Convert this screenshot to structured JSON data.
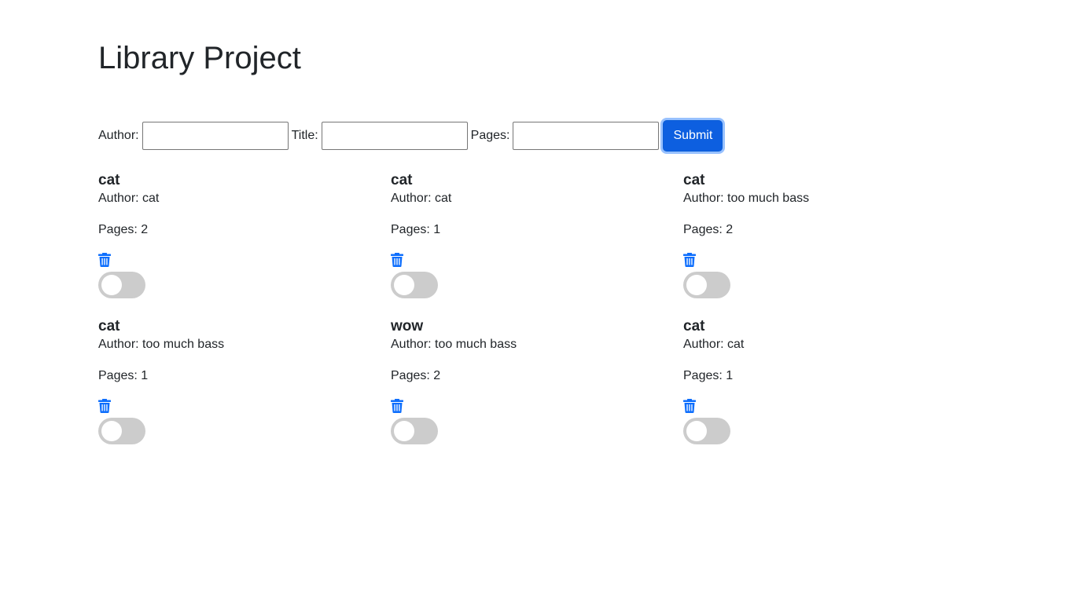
{
  "header": {
    "title": "Library Project"
  },
  "form": {
    "author_label": "Author:",
    "title_label": "Title:",
    "pages_label": "Pages:",
    "author_value": "",
    "title_value": "",
    "pages_value": "",
    "submit_label": "Submit"
  },
  "books": [
    {
      "title": "cat",
      "author": "Author: cat",
      "pages": "Pages: 2"
    },
    {
      "title": "cat",
      "author": "Author: cat",
      "pages": "Pages: 1"
    },
    {
      "title": "cat",
      "author": "Author: too much bass",
      "pages": "Pages: 2"
    },
    {
      "title": "cat",
      "author": "Author: too much bass",
      "pages": "Pages: 1"
    },
    {
      "title": "wow",
      "author": "Author: too much bass",
      "pages": "Pages: 2"
    },
    {
      "title": "cat",
      "author": "Author: cat",
      "pages": "Pages: 1"
    }
  ],
  "icons": {
    "delete": "trash-icon",
    "read_toggle": "toggle-switch"
  },
  "colors": {
    "accent": "#0d6efd",
    "toggle_off": "#cccccc"
  }
}
